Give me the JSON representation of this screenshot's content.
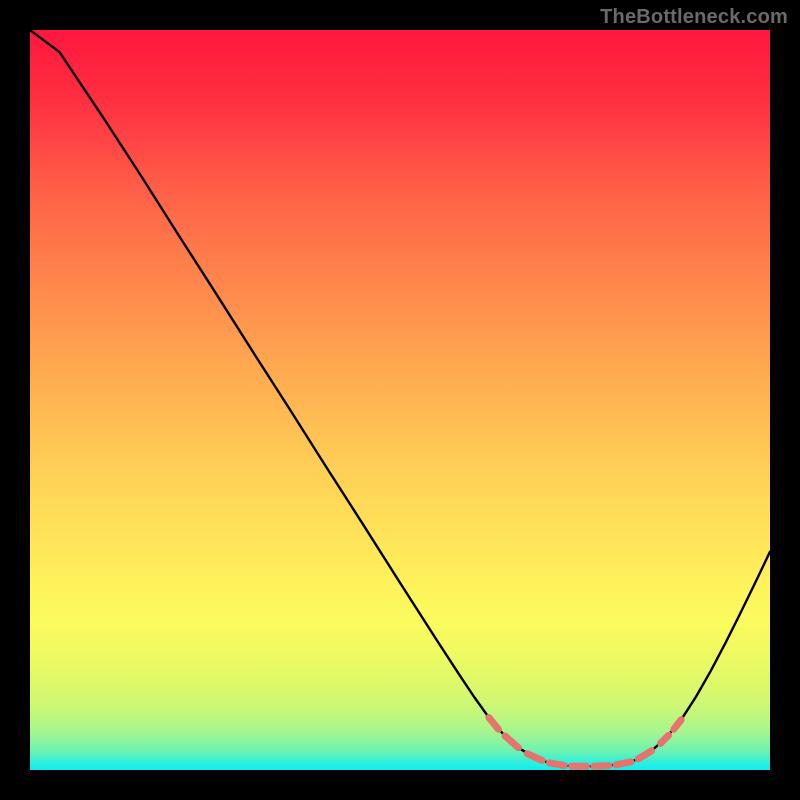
{
  "attribution": "TheBottleneck.com",
  "chart_data": {
    "type": "line",
    "title": "",
    "xlabel": "",
    "ylabel": "",
    "xlim": [
      0,
      100
    ],
    "ylim": [
      0,
      100
    ],
    "curve": [
      {
        "x": 0.0,
        "y": 100.0
      },
      {
        "x": 4.0,
        "y": 97.0
      },
      {
        "x": 6.0,
        "y": 94.0
      },
      {
        "x": 10.0,
        "y": 88.0
      },
      {
        "x": 15.0,
        "y": 80.3
      },
      {
        "x": 20.0,
        "y": 72.4
      },
      {
        "x": 25.0,
        "y": 64.6
      },
      {
        "x": 30.0,
        "y": 56.7
      },
      {
        "x": 35.0,
        "y": 48.9
      },
      {
        "x": 40.0,
        "y": 41.0
      },
      {
        "x": 45.0,
        "y": 33.2
      },
      {
        "x": 50.0,
        "y": 25.3
      },
      {
        "x": 55.0,
        "y": 17.5
      },
      {
        "x": 58.0,
        "y": 12.9
      },
      {
        "x": 60.0,
        "y": 9.9
      },
      {
        "x": 62.0,
        "y": 7.1
      },
      {
        "x": 64.0,
        "y": 4.8
      },
      {
        "x": 66.0,
        "y": 3.0
      },
      {
        "x": 68.0,
        "y": 1.8
      },
      {
        "x": 70.0,
        "y": 1.0
      },
      {
        "x": 72.0,
        "y": 0.6
      },
      {
        "x": 74.0,
        "y": 0.5
      },
      {
        "x": 76.0,
        "y": 0.5
      },
      {
        "x": 78.0,
        "y": 0.6
      },
      {
        "x": 80.0,
        "y": 0.8
      },
      {
        "x": 82.0,
        "y": 1.4
      },
      {
        "x": 84.0,
        "y": 2.6
      },
      {
        "x": 86.0,
        "y": 4.4
      },
      {
        "x": 88.0,
        "y": 6.8
      },
      {
        "x": 90.0,
        "y": 9.9
      },
      {
        "x": 92.0,
        "y": 13.4
      },
      {
        "x": 94.0,
        "y": 17.2
      },
      {
        "x": 96.0,
        "y": 21.2
      },
      {
        "x": 98.0,
        "y": 25.3
      },
      {
        "x": 100.0,
        "y": 29.5
      }
    ],
    "dashed_segments": [
      [
        {
          "x": 62.0,
          "y": 7.1
        },
        {
          "x": 63.3,
          "y": 5.5
        }
      ],
      [
        {
          "x": 64.2,
          "y": 4.6
        },
        {
          "x": 66.0,
          "y": 3.0
        }
      ],
      [
        {
          "x": 67.2,
          "y": 2.2
        },
        {
          "x": 69.2,
          "y": 1.3
        }
      ],
      [
        {
          "x": 70.2,
          "y": 0.95
        },
        {
          "x": 72.2,
          "y": 0.6
        }
      ],
      [
        {
          "x": 73.2,
          "y": 0.52
        },
        {
          "x": 75.2,
          "y": 0.5
        }
      ],
      [
        {
          "x": 76.2,
          "y": 0.5
        },
        {
          "x": 78.2,
          "y": 0.6
        }
      ],
      [
        {
          "x": 79.2,
          "y": 0.7
        },
        {
          "x": 81.2,
          "y": 1.1
        }
      ],
      [
        {
          "x": 82.2,
          "y": 1.5
        },
        {
          "x": 84.0,
          "y": 2.6
        }
      ],
      [
        {
          "x": 85.2,
          "y": 3.6
        },
        {
          "x": 86.3,
          "y": 4.7
        }
      ],
      [
        {
          "x": 87.0,
          "y": 5.5
        },
        {
          "x": 88.0,
          "y": 6.8
        }
      ]
    ],
    "colors": {
      "gradient_top": "#ff173f",
      "gradient_bottom": "#10eef0",
      "curve": "#000000",
      "dashed": "#e5746e"
    }
  }
}
